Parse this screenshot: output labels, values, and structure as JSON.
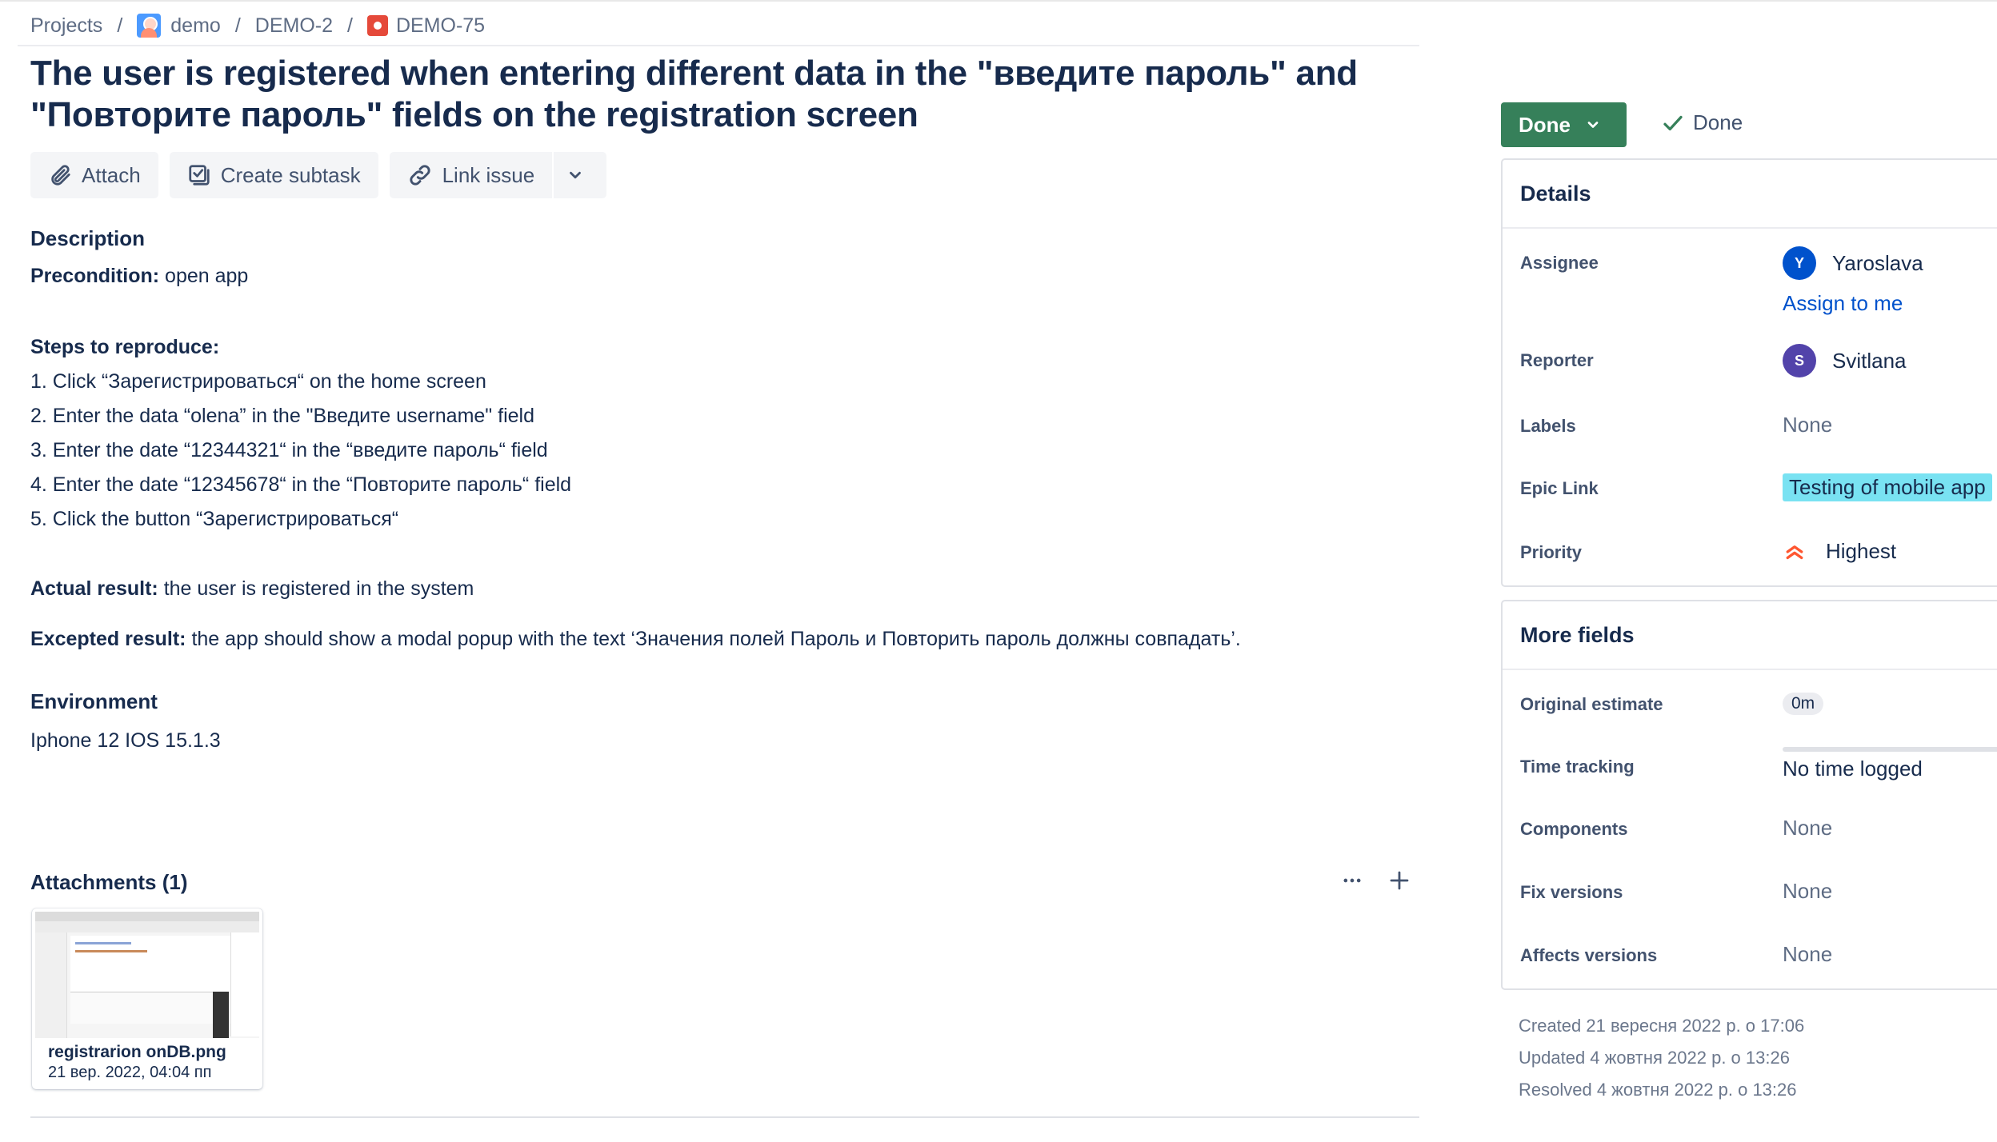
{
  "breadcrumb": {
    "projects": "Projects",
    "project": "demo",
    "epic": "DEMO-2",
    "issue": "DEMO-75",
    "separator": "/"
  },
  "issue": {
    "title": "The user is registered when entering different data in the \"введите пароль\" and \"Повторите пароль\" fields on the registration screen"
  },
  "toolbar": {
    "attach": "Attach",
    "create_subtask": "Create subtask",
    "link_issue": "Link issue"
  },
  "description": {
    "heading": "Description",
    "precondition_label": "Precondition:",
    "precondition_value": " open app",
    "steps_heading": "Steps to reproduce:",
    "steps": [
      "1. Click “Зарегистрироваться“ on the home screen",
      "2. Enter the data “olena” in the \"Введите username\" field",
      "3. Enter the date “12344321“ in the “введите пароль“ field",
      "4. Enter the date “12345678“ in the “Повторите пароль“ field",
      "5. Click the button “Зарегистрироваться“"
    ],
    "actual_label": "Actual result:",
    "actual_value": " the user is registered in the system",
    "expected_label": "Excepted result:",
    "expected_value": " the app should show a modal popup with the text ‘Значения полей Пароль и Повторить пароль должны совпадать’."
  },
  "environment": {
    "heading": "Environment",
    "value": "Iphone 12 IOS 15.1.3"
  },
  "attachments": {
    "heading": "Attachments (1)",
    "more_icon": "ellipsis-icon",
    "add_icon": "plus-icon",
    "items": [
      {
        "name": "registrarion onDB.png",
        "date": "21 вер. 2022, 04:04 пп"
      }
    ]
  },
  "status": {
    "button": "Done",
    "resolution": "Done",
    "color": "#36805a"
  },
  "details": {
    "heading": "Details",
    "assignee_label": "Assignee",
    "assignee_initial": "Y",
    "assignee_name": "Yaroslava",
    "assign_to_me": "Assign to me",
    "reporter_label": "Reporter",
    "reporter_initial": "S",
    "reporter_name": "Svitlana",
    "labels_label": "Labels",
    "labels_value": "None",
    "epic_label": "Epic Link",
    "epic_value": "Testing of mobile app",
    "priority_label": "Priority",
    "priority_value": "Highest"
  },
  "more_fields": {
    "heading": "More fields",
    "original_estimate_label": "Original estimate",
    "original_estimate_value": "0m",
    "time_tracking_label": "Time tracking",
    "time_tracking_value": "No time logged",
    "components_label": "Components",
    "components_value": "None",
    "fix_versions_label": "Fix versions",
    "fix_versions_value": "None",
    "affects_versions_label": "Affects versions",
    "affects_versions_value": "None"
  },
  "meta": {
    "created": "Created 21 вересня 2022 р. о 17:06",
    "updated": "Updated 4 жовтня 2022 р. о 13:26",
    "resolved": "Resolved 4 жовтня 2022 р. о 13:26"
  }
}
